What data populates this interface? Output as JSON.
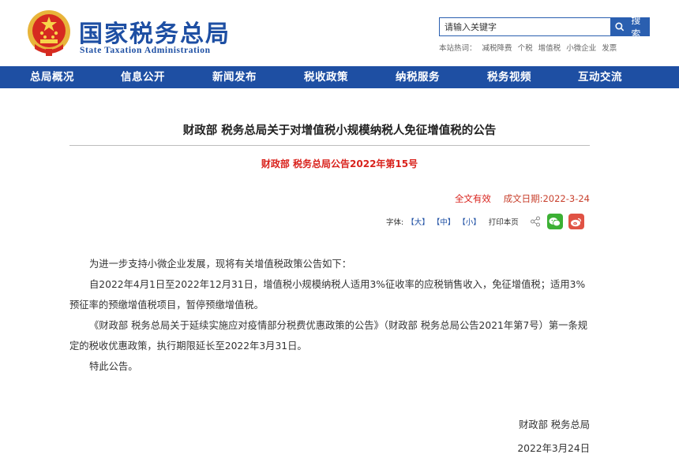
{
  "header": {
    "logo_cn": "国家税务总局",
    "logo_en": "State Taxation Administration",
    "search_placeholder": "请输入关键字",
    "search_button": "搜索",
    "hot_label": "本站热词：",
    "hot_words": [
      "减税降费",
      "个税",
      "增值税",
      "小微企业",
      "发票"
    ]
  },
  "nav": {
    "items": [
      "总局概况",
      "信息公开",
      "新闻发布",
      "税收政策",
      "纳税服务",
      "税务视频",
      "互动交流"
    ]
  },
  "article": {
    "title": "财政部 税务总局关于对增值税小规模纳税人免征增值税的公告",
    "doc_number": "财政部 税务总局公告2022年第15号",
    "status": "全文有效",
    "date_label": "成文日期:",
    "date": "2022-3-24",
    "font_label": "字体:",
    "font_large": "【大】",
    "font_medium": "【中】",
    "font_small": "【小】",
    "print": "打印本页",
    "paragraphs": [
      "为进一步支持小微企业发展，现将有关增值税政策公告如下：",
      "自2022年4月1日至2022年12月31日，增值税小规模纳税人适用3%征收率的应税销售收入，免征增值税；适用3%预征率的预缴增值税项目，暂停预缴增值税。",
      "《财政部 税务总局关于延续实施应对疫情部分税费优惠政策的公告》（财政部 税务总局公告2021年第7号）第一条规定的税收优惠政策，执行期限延长至2022年3月31日。",
      "特此公告。"
    ],
    "signatory": "财政部 税务总局",
    "sign_date": "2022年3月24日"
  },
  "colors": {
    "brand_blue": "#1e4fa3",
    "accent_red": "#d9221c",
    "wechat_green": "#3cb034",
    "weibo_red": "#e05244"
  },
  "icons": [
    "national-emblem-icon",
    "search-icon",
    "share-icon",
    "wechat-icon",
    "weibo-icon"
  ]
}
